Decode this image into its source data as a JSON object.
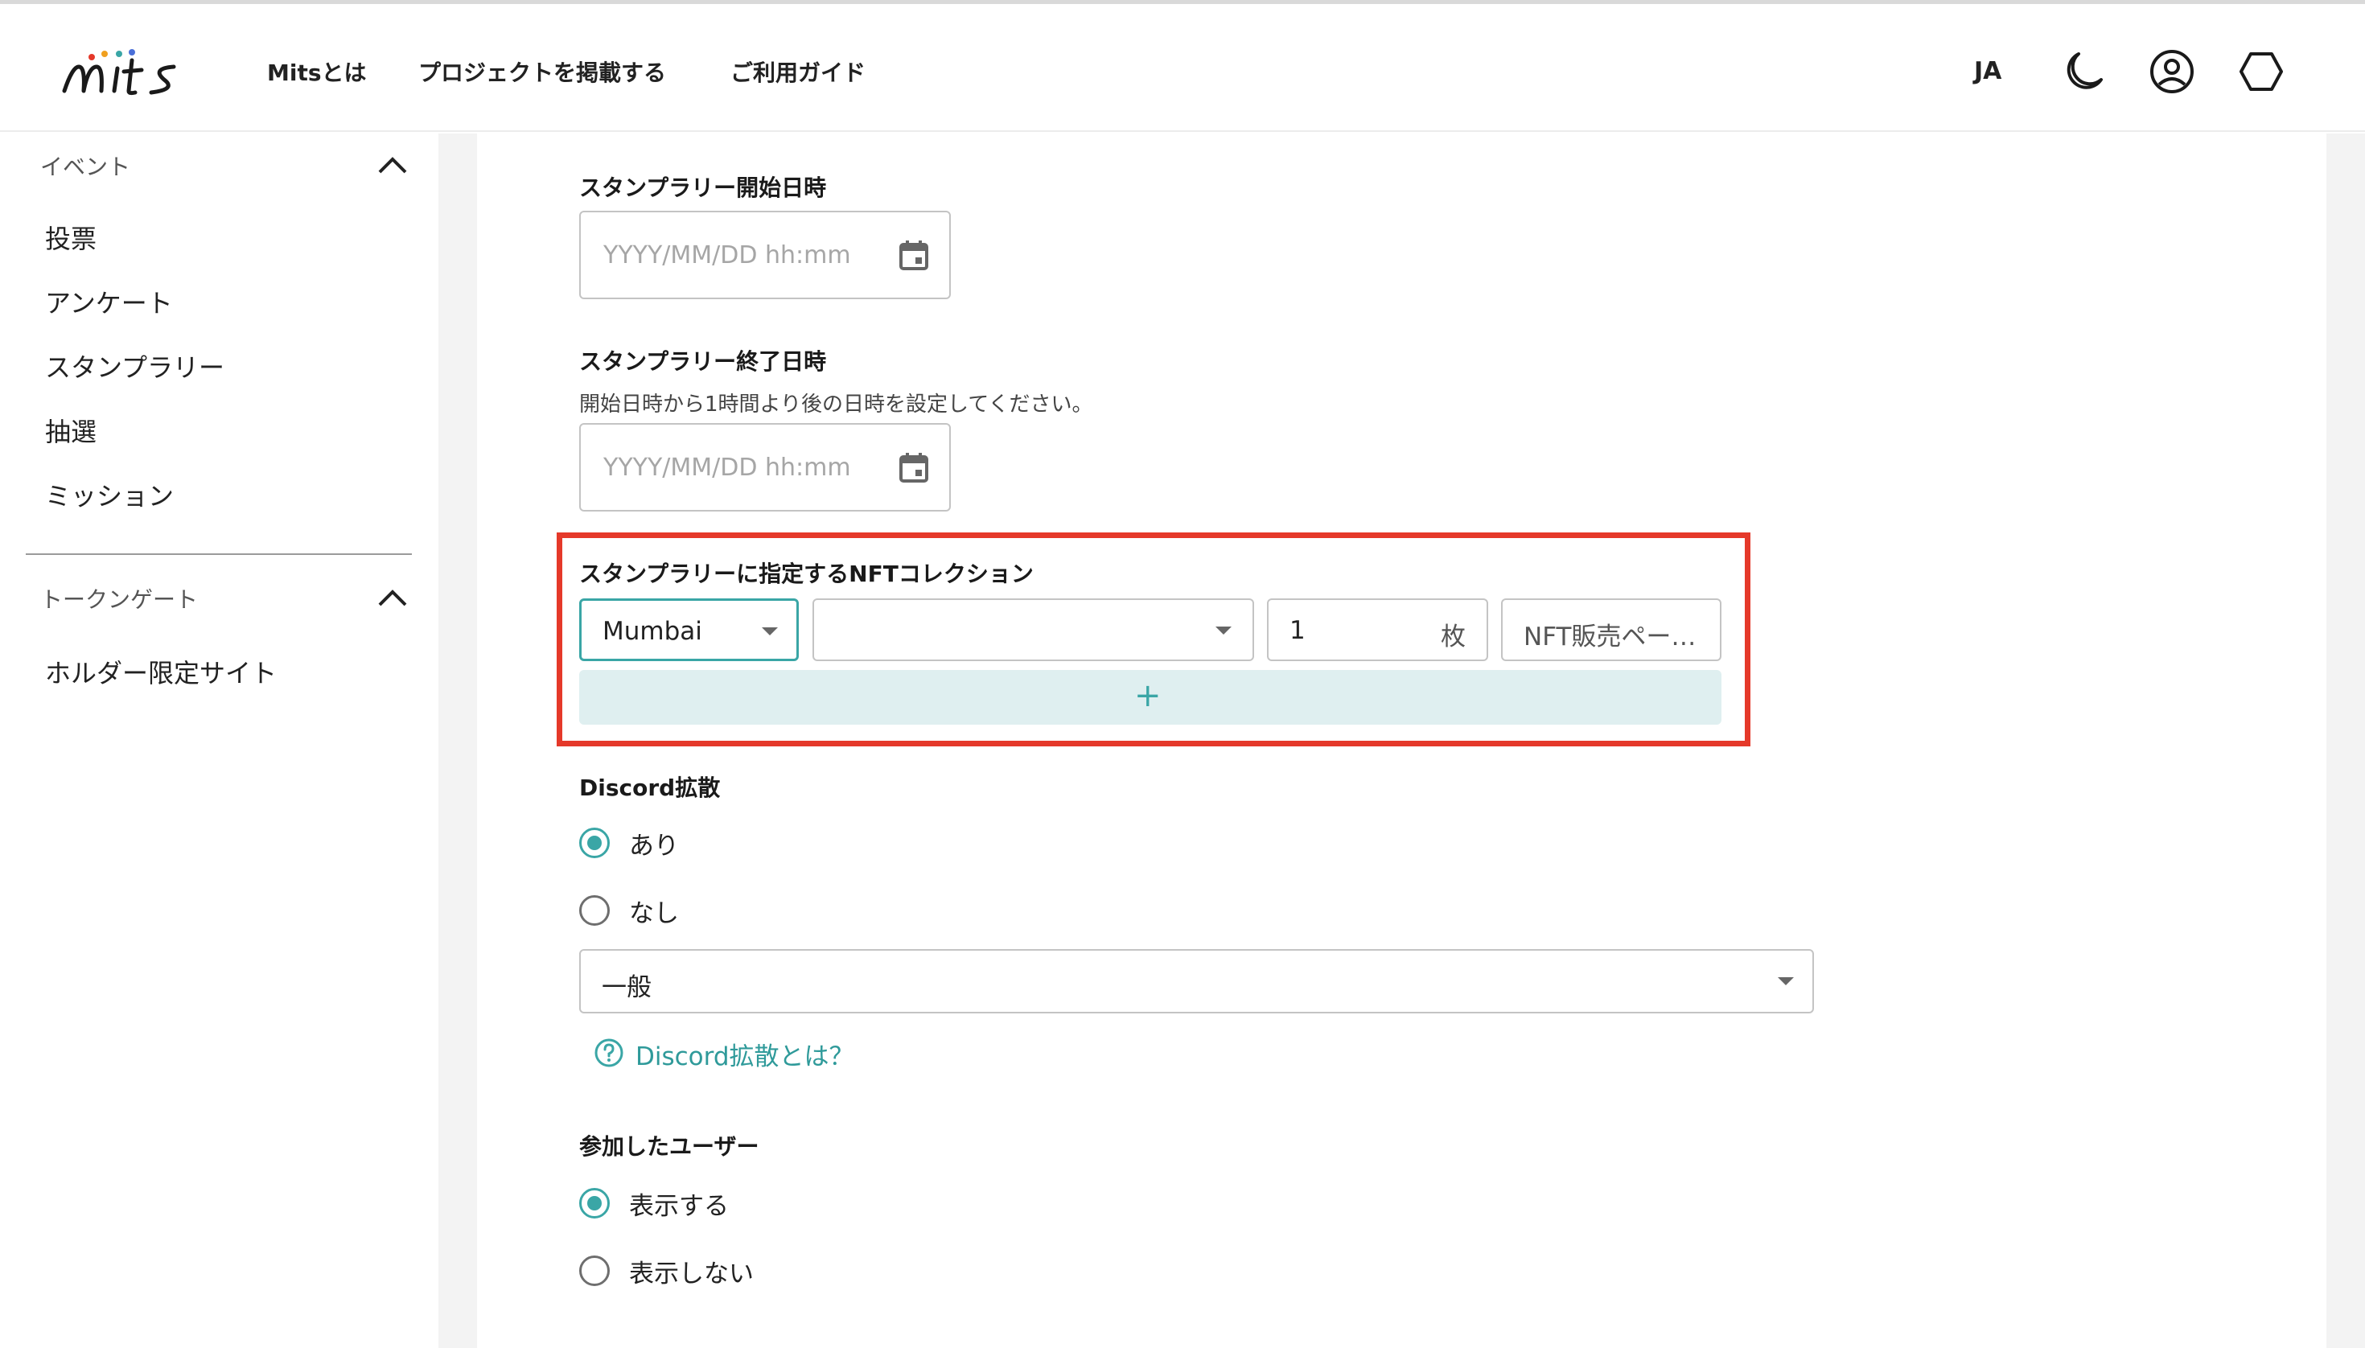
{
  "header": {
    "logo_text": "mits",
    "nav": [
      "Mitsとは",
      "プロジェクトを掲載する",
      "ご利用ガイド"
    ],
    "lang": "JA",
    "icons": [
      "moon-icon",
      "account-icon",
      "wallet-hexagon-icon"
    ]
  },
  "sidebar": {
    "groups": [
      {
        "title": "イベント",
        "items": [
          "投票",
          "アンケート",
          "スタンプラリー",
          "抽選",
          "ミッション"
        ]
      },
      {
        "title": "トークンゲート",
        "items": [
          "ホルダー限定サイト"
        ]
      }
    ]
  },
  "form": {
    "start": {
      "label": "スタンプラリー開始日時",
      "placeholder": "YYYY/MM/DD hh:mm"
    },
    "end": {
      "label": "スタンプラリー終了日時",
      "helper": "開始日時から1時間より後の日時を設定してください。",
      "placeholder": "YYYY/MM/DD hh:mm"
    },
    "nft": {
      "label": "スタンプラリーに指定するNFTコレクション",
      "network": "Mumbai",
      "collection": "",
      "quantity": "1",
      "quantity_unit": "枚",
      "sale_page": "NFT販売ペー…",
      "add_symbol": "+"
    },
    "discord": {
      "label": "Discord拡散",
      "options": [
        "あり",
        "なし"
      ],
      "selected": "あり",
      "channel": "一般",
      "help_link": "Discord拡散とは？"
    },
    "participants": {
      "label": "参加したユーザー",
      "options": [
        "表示する",
        "表示しない"
      ],
      "selected": "表示する"
    }
  },
  "colors": {
    "accent": "#3aa6a6",
    "highlight": "#e5392a",
    "add_bg": "#dfeff0"
  }
}
